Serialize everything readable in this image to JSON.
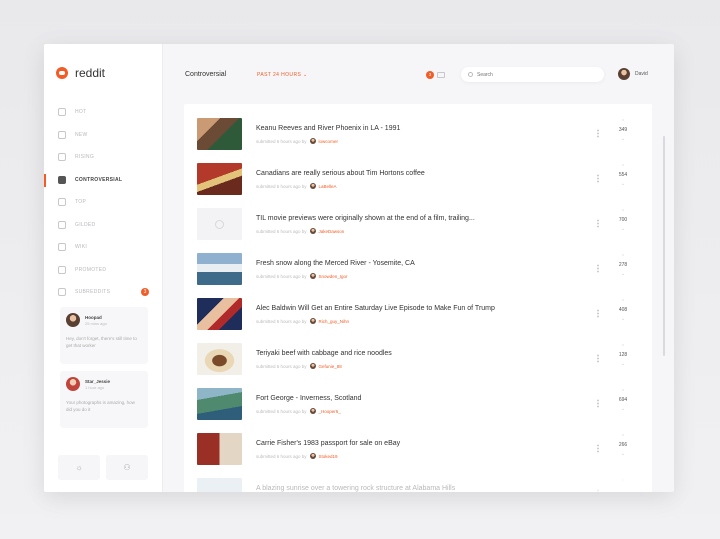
{
  "app": {
    "name": "reddit"
  },
  "sidebar": {
    "items": [
      {
        "label": "HOT",
        "icon": "fire-icon",
        "active": false
      },
      {
        "label": "NEW",
        "icon": "clock-icon",
        "active": false
      },
      {
        "label": "RISING",
        "icon": "chart-icon",
        "active": false
      },
      {
        "label": "CONTROVERSIAL",
        "icon": "controversial-icon",
        "active": true
      },
      {
        "label": "TOP",
        "icon": "trophy-icon",
        "active": false
      },
      {
        "label": "GILDED",
        "icon": "star-icon",
        "active": false
      },
      {
        "label": "WIKI",
        "icon": "book-icon",
        "active": false
      },
      {
        "label": "PROMOTED",
        "icon": "megaphone-icon",
        "active": false
      },
      {
        "label": "SUBREDDITS",
        "icon": "list-icon",
        "active": false,
        "badge": "3"
      }
    ],
    "chats": [
      {
        "name": "Hoopad",
        "time": "25 mins ago",
        "message": "Hey, don't forget, there's still time to get that worker"
      },
      {
        "name": "Star_Jessie",
        "time": "1 hour ago",
        "message": "Your photographs is amazing, how did you do it"
      }
    ],
    "buttons": [
      "☼",
      "⚇"
    ]
  },
  "header": {
    "title": "Controversial",
    "sort_label": "PAST 24 HOURS",
    "notification_count": "3",
    "search_placeholder": "Search",
    "user_name": "David"
  },
  "posts": [
    {
      "title": "Keanu Reeves and River Phoenix in LA - 1991",
      "meta": "submitted 6 hours ago by",
      "author": "lowcorner",
      "score": "349",
      "thumb": "#b07a55"
    },
    {
      "title": "Canadians are really serious about Tim Hortons coffee",
      "meta": "submitted 6 hours ago by",
      "author": "LaBelleA",
      "score": "554",
      "thumb": "#9a3a2a"
    },
    {
      "title": "TIL movie previews were originally shown at the end of a film, trailing...",
      "meta": "submitted 6 hours ago by",
      "author": "JakeDawson",
      "score": "700",
      "thumb": "#f3f3f5"
    },
    {
      "title": "Fresh snow along the Merced River - Yosemite, CA",
      "meta": "submitted 6 hours ago by",
      "author": "Snowden_Igor",
      "score": "278",
      "thumb": "#6f8fae"
    },
    {
      "title": "Alec Baldwin Will Get an Entire Saturday Live Episode to Make Fun of Trump",
      "meta": "submitted 6 hours ago by",
      "author": "Rich_guy_Nihn",
      "score": "408",
      "thumb": "#2f3b6a"
    },
    {
      "title": "Teriyaki beef with cabbage and rice noodles",
      "meta": "submitted 6 hours ago by",
      "author": "Gefunie_88",
      "score": "128",
      "thumb": "#c89a62"
    },
    {
      "title": "Fort George - Inverness, Scotland",
      "meta": "submitted 6 hours ago by",
      "author": "_Hooper6_",
      "score": "694",
      "thumb": "#5a8c7a"
    },
    {
      "title": "Carrie Fisher's 1983 passport for sale on eBay",
      "meta": "submitted 6 hours ago by",
      "author": "Stoked19",
      "score": "266",
      "thumb": "#a84a3a"
    },
    {
      "title": "A blazing sunrise over a towering rock structure at Alabama Hills",
      "meta": "",
      "author": "",
      "score": "",
      "thumb": "#cfd8e3"
    }
  ],
  "colors": {
    "accent": "#f25d27",
    "background": "#f6f6f8",
    "card": "#ffffff"
  }
}
